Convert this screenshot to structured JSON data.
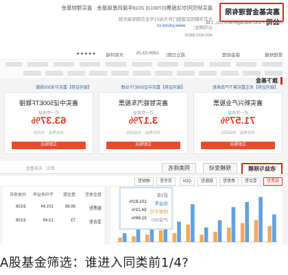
{
  "header": {
    "company_name": "嘉实基金管理有限公司",
    "company_en": "Harvest Fund Management Co., Ltd.",
    "fund_line": "嘉实研究阿尔法股票(070013) 2018年度四星级基金 · 嘉实理财基金",
    "website_label": "公司网址：",
    "website": "www.jsfund.cn",
    "address": "北京市朝阳区建国门外大街21号北京国际俱乐部",
    "phone": "400-600-8800"
  },
  "rating_bar": {
    "rating_label": "天相评级",
    "stars": "★★★★★",
    "established_label": "成立日期：",
    "established": "1999-03-25",
    "manager_label": "基金经理",
    "scale_label": "管理规模"
  },
  "section": {
    "title": "旗下基金",
    "notices": [
      "【银河证券】关注嘉实旗下产品表现",
      "【银河证券】嘉实中证500ETF业绩",
      "【银河证券】嘉实沪深300指数"
    ]
  },
  "cards": [
    {
      "title": "嘉实新兴产业股票",
      "metric_label": "近一年收益",
      "value": "71.57%",
      "note": "风险等级：中高风险",
      "button": "立即购买"
    },
    {
      "title": "嘉实智能汽车股票",
      "metric_label": "近一年收益",
      "value": "3.17%",
      "note": "风险等级：中高风险",
      "button": "立即购买"
    },
    {
      "title": "嘉实中证500ETF联接",
      "metric_label": "近一年收益",
      "value": "63.37%",
      "note": "风险等级：中风险",
      "button": "立即购买"
    }
  ],
  "tabs": {
    "items": [
      "收益与规模",
      "规模变动",
      "同类排名"
    ],
    "right_text": "单位：天天基金"
  },
  "filters": [
    "股票型",
    "混合型",
    "债券型",
    "指数型",
    "QDII",
    "货币型",
    "理财型"
  ],
  "tooltip": {
    "title": "近1年",
    "line1_label": "收益率",
    "line1_value": "101.81%",
    "line2_label": "同类平均",
    "line2_value": "34.21%",
    "line3_label": "沪深300",
    "line3_value": "32.86%"
  },
  "table": {
    "headers": [
      "基金类型",
      "基金数",
      "平均收益率",
      "同类排名"
    ],
    "rows": [
      [
        "股票型",
        "86.68",
        "101.64",
        "3/108"
      ],
      [
        "混合型",
        "73",
        "13.49",
        "3/108"
      ]
    ]
  },
  "chart_data": {
    "type": "bar",
    "categories": [
      "",
      "",
      "",
      "",
      "",
      "",
      "",
      "",
      "",
      "",
      "",
      ""
    ],
    "series": [
      {
        "values": [
          38,
          62,
          55,
          48,
          30,
          20,
          52,
          28,
          35,
          22,
          18,
          12
        ]
      },
      {
        "values": [
          22,
          30,
          26,
          20,
          14,
          10,
          24,
          12,
          16,
          10,
          8,
          6
        ]
      }
    ],
    "colors": [
      "#4a90d9",
      "#f29b38"
    ],
    "ylim": [
      0,
      70
    ]
  },
  "caption": "A股基金筛选：谁进入同类前1/4?"
}
